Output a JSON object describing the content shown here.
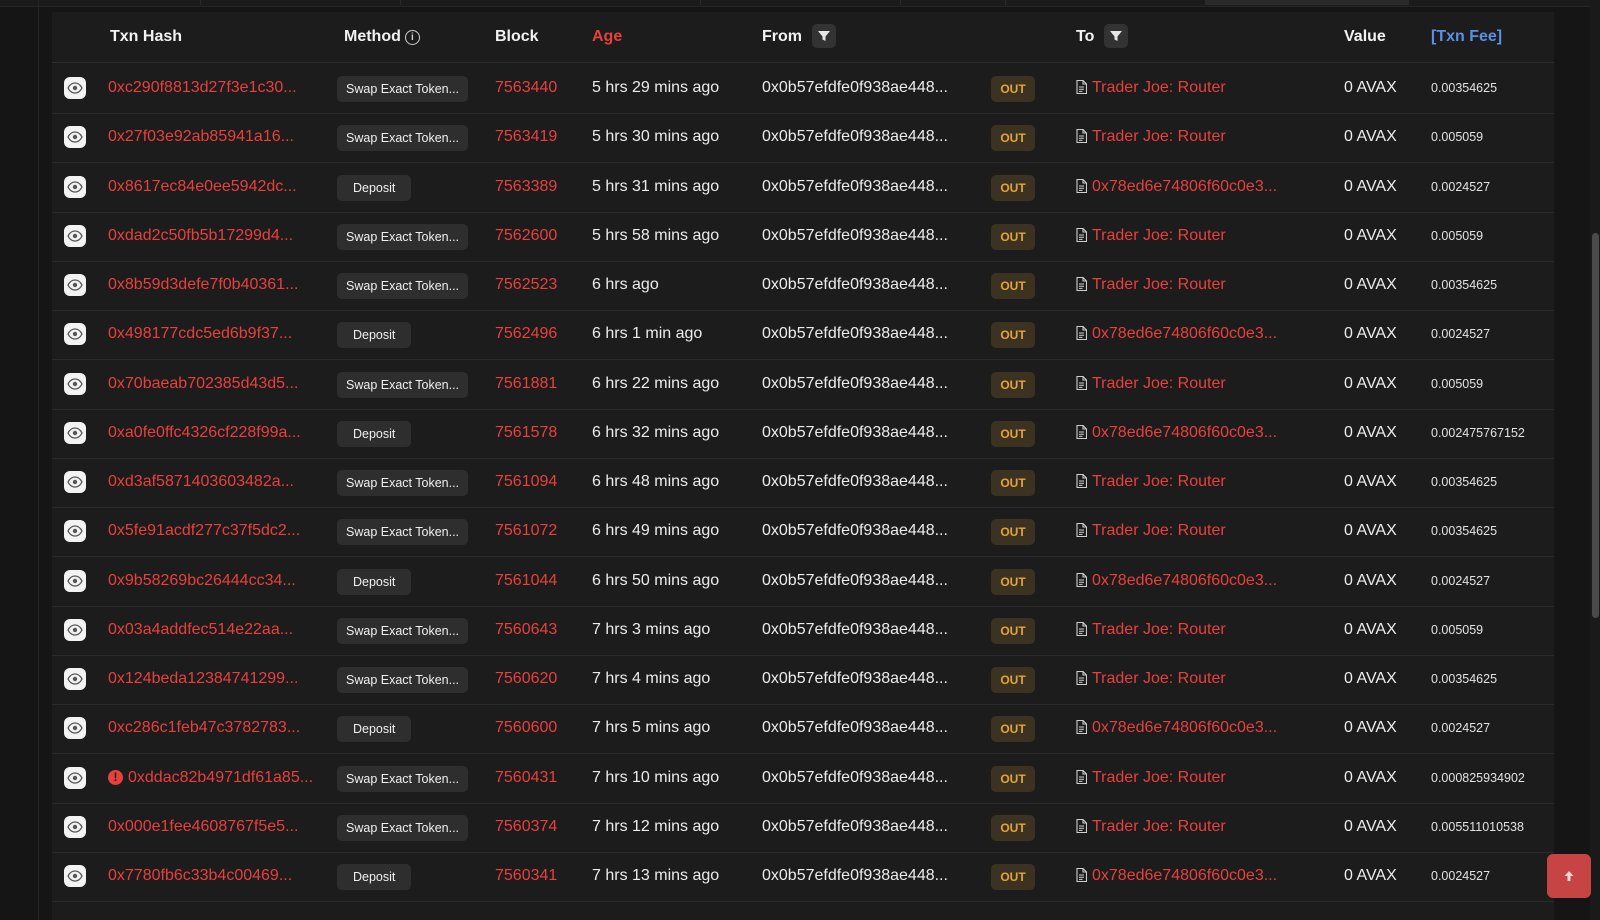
{
  "columns": {
    "txn_hash": "Txn Hash",
    "method": "Method",
    "block": "Block",
    "age": "Age",
    "from": "From",
    "to": "To",
    "value": "Value",
    "txn_fee": "[Txn Fee]"
  },
  "direction_label": "OUT",
  "colors": {
    "background": "#151515",
    "card": "#1c1c1c",
    "link_red": "#e8403d",
    "fee_header_blue": "#5c8fe6",
    "out_badge_text": "#e6a33a",
    "out_badge_bg": "#3b3222",
    "back_to_top": "#c74444"
  },
  "icons": {
    "row_action": "eye-icon",
    "to_contract": "document-icon",
    "filter": "filter-icon",
    "method_info": "info-icon",
    "error": "exclamation-icon",
    "scroll_top": "arrow-up-icon"
  },
  "rows": [
    {
      "hash": "0xc290f8813d27f3e1c30...",
      "method": "Swap Exact Token...",
      "block": "7563440",
      "age": "5 hrs 29 mins ago",
      "from": "0x0b57efdfe0f938ae448...",
      "to": "Trader Joe: Router",
      "value": "0 AVAX",
      "fee": "0.00354625",
      "error": false
    },
    {
      "hash": "0x27f03e92ab85941a16...",
      "method": "Swap Exact Token...",
      "block": "7563419",
      "age": "5 hrs 30 mins ago",
      "from": "0x0b57efdfe0f938ae448...",
      "to": "Trader Joe: Router",
      "value": "0 AVAX",
      "fee": "0.005059",
      "error": false
    },
    {
      "hash": "0x8617ec84e0ee5942dc...",
      "method": "Deposit",
      "block": "7563389",
      "age": "5 hrs 31 mins ago",
      "from": "0x0b57efdfe0f938ae448...",
      "to": "0x78ed6e74806f60c0e3...",
      "value": "0 AVAX",
      "fee": "0.0024527",
      "error": false
    },
    {
      "hash": "0xdad2c50fb5b17299d4...",
      "method": "Swap Exact Token...",
      "block": "7562600",
      "age": "5 hrs 58 mins ago",
      "from": "0x0b57efdfe0f938ae448...",
      "to": "Trader Joe: Router",
      "value": "0 AVAX",
      "fee": "0.005059",
      "error": false
    },
    {
      "hash": "0x8b59d3defe7f0b40361...",
      "method": "Swap Exact Token...",
      "block": "7562523",
      "age": "6 hrs ago",
      "from": "0x0b57efdfe0f938ae448...",
      "to": "Trader Joe: Router",
      "value": "0 AVAX",
      "fee": "0.00354625",
      "error": false
    },
    {
      "hash": "0x498177cdc5ed6b9f37...",
      "method": "Deposit",
      "block": "7562496",
      "age": "6 hrs 1 min ago",
      "from": "0x0b57efdfe0f938ae448...",
      "to": "0x78ed6e74806f60c0e3...",
      "value": "0 AVAX",
      "fee": "0.0024527",
      "error": false
    },
    {
      "hash": "0x70baeab702385d43d5...",
      "method": "Swap Exact Token...",
      "block": "7561881",
      "age": "6 hrs 22 mins ago",
      "from": "0x0b57efdfe0f938ae448...",
      "to": "Trader Joe: Router",
      "value": "0 AVAX",
      "fee": "0.005059",
      "error": false
    },
    {
      "hash": "0xa0fe0ffc4326cf228f99a...",
      "method": "Deposit",
      "block": "7561578",
      "age": "6 hrs 32 mins ago",
      "from": "0x0b57efdfe0f938ae448...",
      "to": "0x78ed6e74806f60c0e3...",
      "value": "0 AVAX",
      "fee": "0.002475767152",
      "error": false
    },
    {
      "hash": "0xd3af5871403603482a...",
      "method": "Swap Exact Token...",
      "block": "7561094",
      "age": "6 hrs 48 mins ago",
      "from": "0x0b57efdfe0f938ae448...",
      "to": "Trader Joe: Router",
      "value": "0 AVAX",
      "fee": "0.00354625",
      "error": false
    },
    {
      "hash": "0x5fe91acdf277c37f5dc2...",
      "method": "Swap Exact Token...",
      "block": "7561072",
      "age": "6 hrs 49 mins ago",
      "from": "0x0b57efdfe0f938ae448...",
      "to": "Trader Joe: Router",
      "value": "0 AVAX",
      "fee": "0.00354625",
      "error": false
    },
    {
      "hash": "0x9b58269bc26444cc34...",
      "method": "Deposit",
      "block": "7561044",
      "age": "6 hrs 50 mins ago",
      "from": "0x0b57efdfe0f938ae448...",
      "to": "0x78ed6e74806f60c0e3...",
      "value": "0 AVAX",
      "fee": "0.0024527",
      "error": false
    },
    {
      "hash": "0x03a4addfec514e22aa...",
      "method": "Swap Exact Token...",
      "block": "7560643",
      "age": "7 hrs 3 mins ago",
      "from": "0x0b57efdfe0f938ae448...",
      "to": "Trader Joe: Router",
      "value": "0 AVAX",
      "fee": "0.005059",
      "error": false
    },
    {
      "hash": "0x124beda12384741299...",
      "method": "Swap Exact Token...",
      "block": "7560620",
      "age": "7 hrs 4 mins ago",
      "from": "0x0b57efdfe0f938ae448...",
      "to": "Trader Joe: Router",
      "value": "0 AVAX",
      "fee": "0.00354625",
      "error": false
    },
    {
      "hash": "0xc286c1feb47c3782783...",
      "method": "Deposit",
      "block": "7560600",
      "age": "7 hrs 5 mins ago",
      "from": "0x0b57efdfe0f938ae448...",
      "to": "0x78ed6e74806f60c0e3...",
      "value": "0 AVAX",
      "fee": "0.0024527",
      "error": false
    },
    {
      "hash": "0xddac82b4971df61a85...",
      "method": "Swap Exact Token...",
      "block": "7560431",
      "age": "7 hrs 10 mins ago",
      "from": "0x0b57efdfe0f938ae448...",
      "to": "Trader Joe: Router",
      "value": "0 AVAX",
      "fee": "0.000825934902",
      "error": true
    },
    {
      "hash": "0x000e1fee4608767f5e5...",
      "method": "Swap Exact Token...",
      "block": "7560374",
      "age": "7 hrs 12 mins ago",
      "from": "0x0b57efdfe0f938ae448...",
      "to": "Trader Joe: Router",
      "value": "0 AVAX",
      "fee": "0.005511010538",
      "error": false
    },
    {
      "hash": "0x7780fb6c33b4c00469...",
      "method": "Deposit",
      "block": "7560341",
      "age": "7 hrs 13 mins ago",
      "from": "0x0b57efdfe0f938ae448...",
      "to": "0x78ed6e74806f60c0e3...",
      "value": "0 AVAX",
      "fee": "0.0024527",
      "error": false
    }
  ]
}
